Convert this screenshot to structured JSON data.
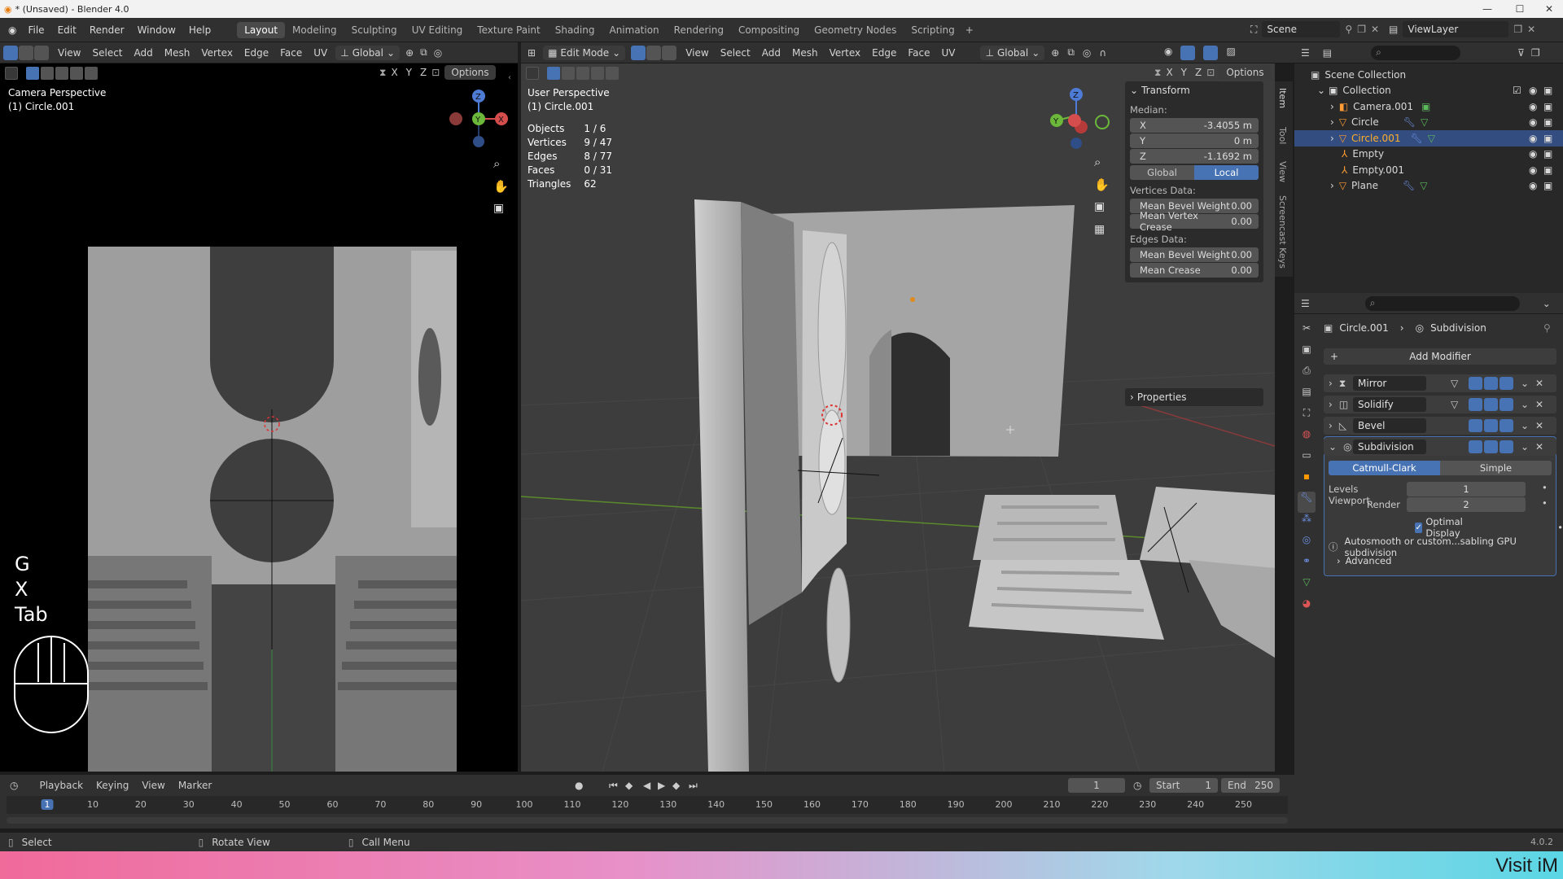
{
  "titlebar": {
    "title": "* (Unsaved) - Blender 4.0"
  },
  "menu": [
    "File",
    "Edit",
    "Render",
    "Window",
    "Help"
  ],
  "workspaces": [
    "Layout",
    "Modeling",
    "Sculpting",
    "UV Editing",
    "Texture Paint",
    "Shading",
    "Animation",
    "Rendering",
    "Compositing",
    "Geometry Nodes",
    "Scripting"
  ],
  "active_workspace": "Layout",
  "scene": "Scene",
  "view_layer": "ViewLayer",
  "left_viewport": {
    "header_menus": [
      "View",
      "Select",
      "Add",
      "Mesh",
      "Vertex",
      "Edge",
      "Face",
      "UV"
    ],
    "transform_orientation": "Global",
    "options": "Options",
    "axes": [
      "X",
      "Y",
      "Z"
    ],
    "overlay_title": "Camera Perspective",
    "overlay_object": "(1) Circle.001",
    "keys": [
      "G",
      "X",
      "Tab"
    ]
  },
  "right_viewport": {
    "mode": "Edit Mode",
    "header_menus": [
      "View",
      "Select",
      "Add",
      "Mesh",
      "Vertex",
      "Edge",
      "Face",
      "UV"
    ],
    "transform_orientation": "Global",
    "options": "Options",
    "axes": [
      "X",
      "Y",
      "Z"
    ],
    "overlay_title": "User Perspective",
    "overlay_object": "(1) Circle.001",
    "stats": [
      {
        "label": "Objects",
        "value": "1 / 6"
      },
      {
        "label": "Vertices",
        "value": "9 / 47"
      },
      {
        "label": "Edges",
        "value": "8 / 77"
      },
      {
        "label": "Faces",
        "value": "0 / 31"
      },
      {
        "label": "Triangles",
        "value": "62"
      }
    ]
  },
  "npanel": {
    "section": "Transform",
    "median_label": "Median:",
    "fields": [
      {
        "label": "X",
        "value": "-3.4055 m"
      },
      {
        "label": "Y",
        "value": "0 m"
      },
      {
        "label": "Z",
        "value": "-1.1692 m"
      }
    ],
    "space_global": "Global",
    "space_local": "Local",
    "vertices_data": "Vertices Data:",
    "vertex_fields": [
      {
        "label": "Mean Bevel Weight",
        "value": "0.00"
      },
      {
        "label": "Mean Vertex Crease",
        "value": "0.00"
      }
    ],
    "edges_data": "Edges Data:",
    "edge_fields": [
      {
        "label": "Mean Bevel Weight",
        "value": "0.00"
      },
      {
        "label": "Mean Crease",
        "value": "0.00"
      }
    ],
    "properties": "Properties",
    "tabs": [
      "Item",
      "Tool",
      "View",
      "Screencast Keys"
    ]
  },
  "outliner": {
    "root": "Scene Collection",
    "collection": "Collection",
    "items": [
      "Camera.001",
      "Circle",
      "Circle.001",
      "Empty",
      "Empty.001",
      "Plane"
    ],
    "active": "Circle.001"
  },
  "properties": {
    "breadcrumb_object": "Circle.001",
    "breadcrumb_modifier": "Subdivision",
    "add_modifier": "Add Modifier",
    "modifiers": [
      "Mirror",
      "Solidify",
      "Bevel",
      "Subdivision"
    ],
    "subdiv": {
      "catmull": "Catmull-Clark",
      "simple": "Simple",
      "levels_label": "Levels Viewport",
      "levels_value": "1",
      "render_label": "Render",
      "render_value": "2",
      "optimal": "Optimal Display",
      "warning": "Autosmooth or custom...sabling GPU subdivision",
      "advanced": "Advanced"
    }
  },
  "timeline": {
    "menus": [
      "Playback",
      "Keying",
      "View",
      "Marker"
    ],
    "current_frame": "1",
    "start_label": "Start",
    "start": "1",
    "end_label": "End",
    "end": "250",
    "ruler": [
      "1",
      "10",
      "20",
      "30",
      "40",
      "50",
      "60",
      "70",
      "80",
      "90",
      "100",
      "110",
      "120",
      "130",
      "140",
      "150",
      "160",
      "170",
      "180",
      "190",
      "200",
      "210",
      "220",
      "230",
      "240",
      "250"
    ]
  },
  "statusbar": {
    "select": "Select",
    "rotate": "Rotate View",
    "menu": "Call Menu",
    "version": "4.0.2"
  },
  "banner": {
    "text": "Visit iM"
  },
  "colors": {
    "accent": "#4772b3",
    "active_object": "#ffaf29",
    "selected_row": "#334d80"
  }
}
